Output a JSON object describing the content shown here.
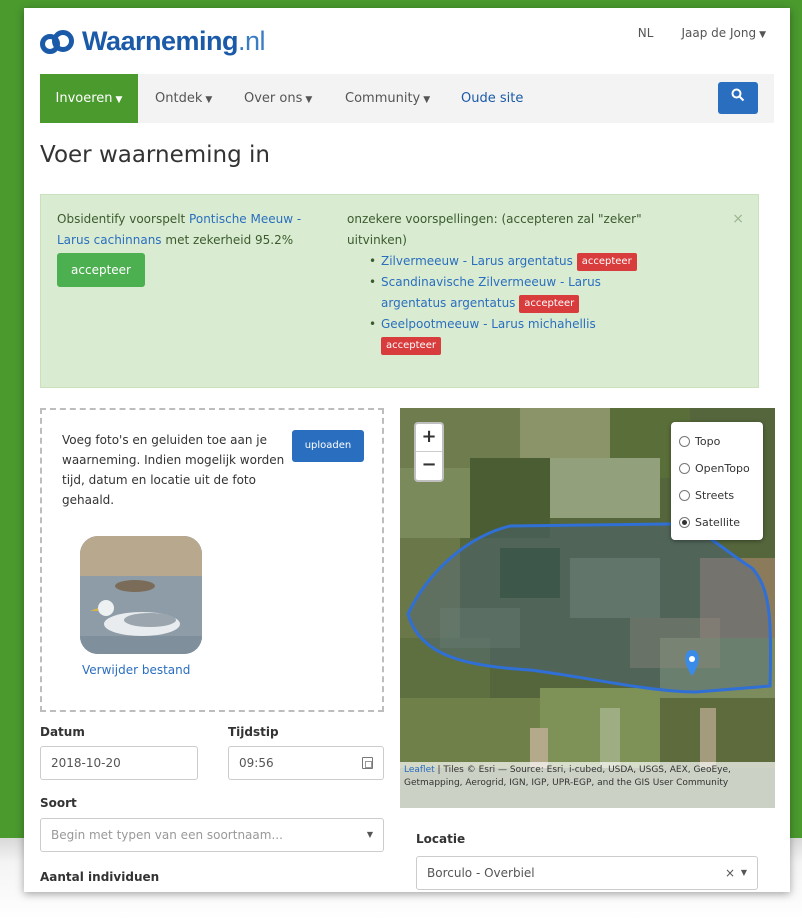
{
  "header": {
    "logo_text": "Waarneming",
    "logo_suffix": ".nl",
    "language": "NL",
    "user": "Jaap de Jong"
  },
  "nav": {
    "items": [
      {
        "label": "Invoeren",
        "dropdown": true
      },
      {
        "label": "Ontdek",
        "dropdown": true
      },
      {
        "label": "Over ons",
        "dropdown": true
      },
      {
        "label": "Community",
        "dropdown": true
      },
      {
        "label": "Oude site",
        "dropdown": false
      }
    ],
    "search_icon": "search-icon"
  },
  "page_title": "Voer waarneming in",
  "suggestion": {
    "intro_prefix": "Obsidentify voorspelt ",
    "species_link": "Pontische Meeuw - Larus cachinnans",
    "intro_suffix": " met zekerheid 95.2%",
    "accept_label": "accepteer",
    "uncertain_text": "onzekere voorspellingen: (accepteren zal \"zeker\" uitvinken)",
    "alternatives": [
      {
        "name": "Zilvermeeuw - Larus argentatus",
        "accept_label": "accepteer"
      },
      {
        "name": "Scandinavische Zilvermeeuw - Larus argentatus argentatus",
        "accept_label": "accepteer"
      },
      {
        "name": "Geelpootmeeuw - Larus michahellis",
        "accept_label": "accepteer"
      }
    ],
    "close_label": "×"
  },
  "upload": {
    "text": "Voeg foto's en geluiden toe aan je waarneming. Indien mogelijk worden tijd, datum en locatie uit de foto gehaald.",
    "button_label": "uploaden",
    "remove_label": "Verwijder bestand"
  },
  "form": {
    "datum_label": "Datum",
    "datum_value": "2018-10-20",
    "tijdstip_label": "Tijdstip",
    "tijdstip_value": "09:56",
    "soort_label": "Soort",
    "soort_placeholder": "Begin met typen van een soortnaam...",
    "aantal_label": "Aantal individuen",
    "locatie_label": "Locatie",
    "locatie_value": "Borculo - Overbiel"
  },
  "map": {
    "zoom_in": "+",
    "zoom_out": "−",
    "layers": [
      {
        "label": "Topo",
        "selected": false
      },
      {
        "label": "OpenTopo",
        "selected": false
      },
      {
        "label": "Streets",
        "selected": false
      },
      {
        "label": "Satellite",
        "selected": true
      }
    ],
    "attribution_link": "Leaflet",
    "attribution_text": " | Tiles © Esri — Source: Esri, i-cubed, USDA, USGS, AEX, GeoEye, Getmapping, Aerogrid, IGN, IGP, UPR-EGP, and the GIS User Community"
  }
}
